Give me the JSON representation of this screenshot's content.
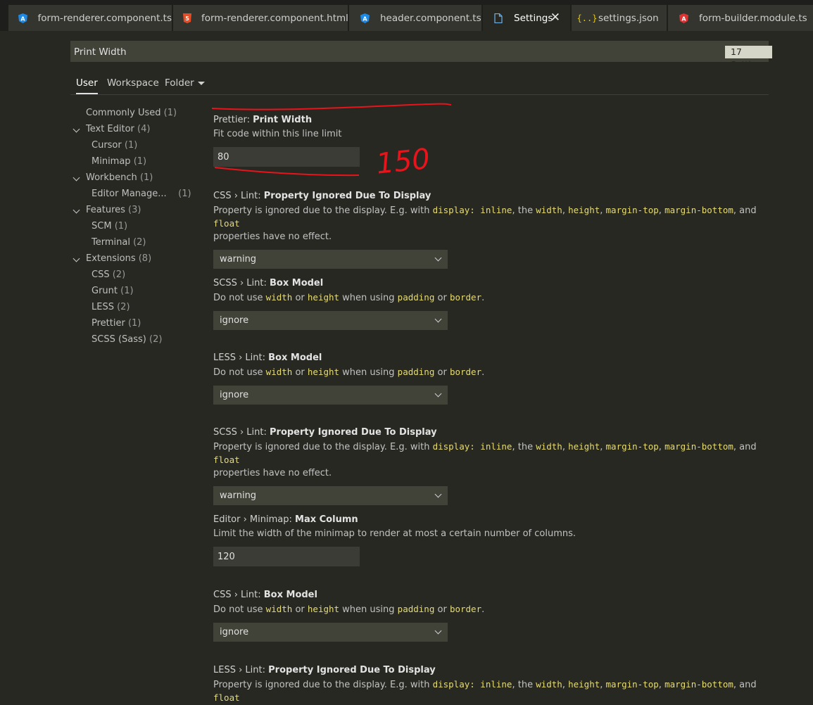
{
  "tabs": [
    {
      "label": "form-renderer.component.ts",
      "icon": "angular-icon"
    },
    {
      "label": "form-renderer.component.html",
      "icon": "html5-icon"
    },
    {
      "label": "header.component.ts",
      "icon": "angular-icon"
    },
    {
      "label": "Settings",
      "icon": "file-icon"
    },
    {
      "label": "settings.json",
      "icon": "json-braces-icon"
    },
    {
      "label": "form-builder.module.ts",
      "icon": "angular-icon"
    }
  ],
  "tab_close": "✕",
  "search": {
    "value": "Print Width",
    "badge": "17 Settings Found"
  },
  "scopes": {
    "user": "User",
    "workspace": "Workspace",
    "folder": "Folder"
  },
  "tree": [
    {
      "label": "Commonly Used",
      "count": "(1)"
    },
    {
      "label": "Text Editor",
      "count": "(4)"
    },
    {
      "label": "Cursor",
      "count": "(1)"
    },
    {
      "label": "Minimap",
      "count": "(1)"
    },
    {
      "label": "Workbench",
      "count": "(1)"
    },
    {
      "label": "Editor Manage...",
      "count": "(1)"
    },
    {
      "label": "Features",
      "count": "(3)"
    },
    {
      "label": "SCM",
      "count": "(1)"
    },
    {
      "label": "Terminal",
      "count": "(2)"
    },
    {
      "label": "Extensions",
      "count": "(8)"
    },
    {
      "label": "CSS",
      "count": "(2)"
    },
    {
      "label": "Grunt",
      "count": "(1)"
    },
    {
      "label": "LESS",
      "count": "(2)"
    },
    {
      "label": "Prettier",
      "count": "(1)"
    },
    {
      "label": "SCSS (Sass)",
      "count": "(2)"
    }
  ],
  "words": {
    "desc_display_a": "Property is ignored due to the display. E.g. with ",
    "code_display": "display: inline",
    "the": ", the ",
    "width": "width",
    "height": "height",
    "margin_top": "margin-top",
    "margin_bottom": "margin-bottom",
    "float": "float",
    "comma": ", ",
    "and": ", and ",
    "no_effect": "properties have no effect.",
    "do_not_use": "Do not use ",
    "or": " or ",
    "when_using": " when using ",
    "padding": "padding",
    "border": "border",
    "period": "."
  },
  "settings": {
    "print_width": {
      "prefix": "Prettier: ",
      "name": "Print Width",
      "desc": "Fit code within this line limit",
      "value": "80"
    },
    "css_ignored": {
      "prefix": "CSS › Lint: ",
      "name": "Property Ignored Due To Display",
      "value": "warning"
    },
    "scss_box": {
      "prefix": "SCSS › Lint: ",
      "name": "Box Model",
      "value": "ignore"
    },
    "less_box": {
      "prefix": "LESS › Lint: ",
      "name": "Box Model",
      "value": "ignore"
    },
    "scss_ignored": {
      "prefix": "SCSS › Lint: ",
      "name": "Property Ignored Due To Display",
      "value": "warning"
    },
    "minimap": {
      "prefix": "Editor › Minimap: ",
      "name": "Max Column",
      "desc": "Limit the width of the minimap to render at most a certain number of columns.",
      "value": "120"
    },
    "css_box": {
      "prefix": "CSS › Lint: ",
      "name": "Box Model",
      "value": "ignore"
    },
    "less_ignored": {
      "prefix": "LESS › Lint: ",
      "name": "Property Ignored Due To Display"
    }
  },
  "annotation": {
    "text": "150",
    "color": "#e8141b"
  },
  "colors": {
    "background": "#272822",
    "accent_code": "#e6db74",
    "angular": "#1e88e5",
    "html5": "#e44d26",
    "json": "#e6c700",
    "angular_red": "#dd3333"
  }
}
